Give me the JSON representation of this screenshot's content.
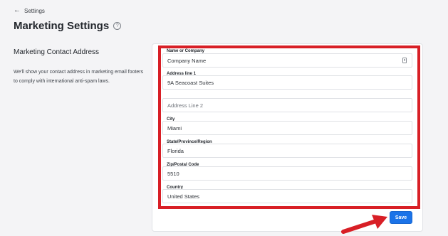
{
  "nav": {
    "back_label": "Settings"
  },
  "page": {
    "title": "Marketing Settings"
  },
  "section": {
    "title": "Marketing Contact Address",
    "description": "We'll show your contact address in marketing email footers to comply with international anti-spam laws."
  },
  "form": {
    "company": {
      "label": "Name or Company",
      "value": "Company Name"
    },
    "address1": {
      "label": "Address line 1",
      "value": "9A Seacoast Suites"
    },
    "address2": {
      "placeholder": "Address Line 2"
    },
    "city": {
      "label": "City",
      "value": "Miami"
    },
    "state": {
      "label": "State/Province/Region",
      "value": "Florida"
    },
    "zip": {
      "label": "Zip/Postal Code",
      "value": "5510"
    },
    "country": {
      "label": "Country",
      "value": "United States"
    }
  },
  "actions": {
    "save_label": "Save"
  },
  "colors": {
    "highlight": "#d81f26",
    "primary": "#1b73e8"
  },
  "icons": {
    "back": "arrow-left-icon",
    "help": "help-circle-icon",
    "contact": "contact-card-icon"
  }
}
